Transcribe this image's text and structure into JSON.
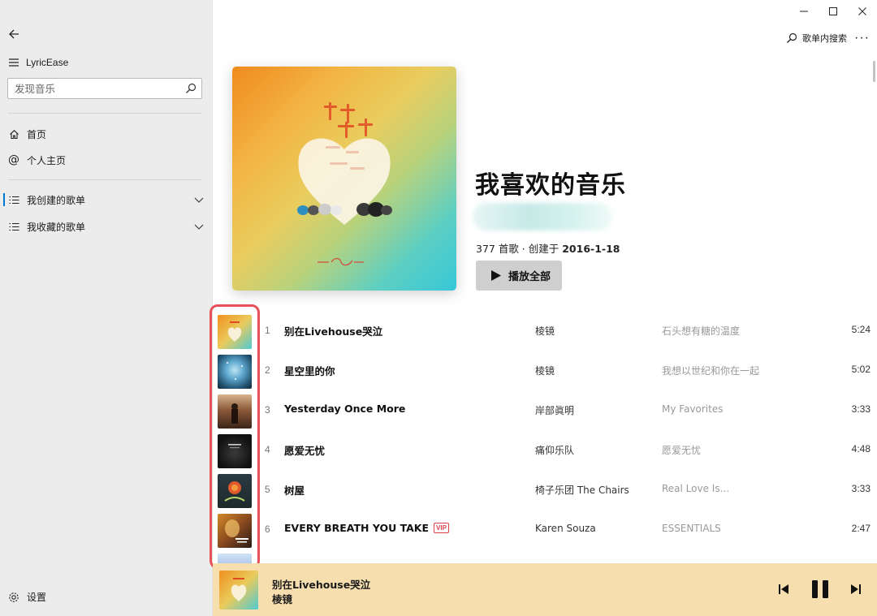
{
  "sidebar": {
    "app_name": "LyricEase",
    "search_placeholder": "发现音乐",
    "nav": [
      {
        "label": "首页",
        "icon": "home-icon"
      },
      {
        "label": "个人主页",
        "icon": "at-icon"
      }
    ],
    "playlist_groups": [
      {
        "label": "我创建的歌单",
        "icon": "list-icon",
        "selected": true
      },
      {
        "label": "我收藏的歌单",
        "icon": "list-icon",
        "selected": false
      }
    ],
    "settings_label": "设置"
  },
  "header": {
    "search_in_playlist": "歌单内搜索",
    "more_label": "···"
  },
  "playlist": {
    "title": "我喜欢的音乐",
    "meta_prefix": "377 首歌 · 创建于 ",
    "created_date": "2016-1-18",
    "play_all_label": "播放全部"
  },
  "tracks": [
    {
      "index": "1",
      "title": "别在Livehouse哭泣",
      "artist": "棱镜",
      "album": "石头想有糖的温度",
      "duration": "5:24",
      "vip": false
    },
    {
      "index": "2",
      "title": "星空里的你",
      "artist": "棱镜",
      "album": "我想以世纪和你在一起",
      "duration": "5:02",
      "vip": false
    },
    {
      "index": "3",
      "title": "Yesterday Once More",
      "artist": "岸部眞明",
      "album": "My Favorites",
      "duration": "3:33",
      "vip": false
    },
    {
      "index": "4",
      "title": "愿爱无忧",
      "artist": "痛仰乐队",
      "album": "愿爱无忧",
      "duration": "4:48",
      "vip": false
    },
    {
      "index": "5",
      "title": "树屋",
      "artist": "椅子乐团 The Chairs",
      "album": "Real Love Is...",
      "duration": "3:33",
      "vip": false
    },
    {
      "index": "6",
      "title": "EVERY BREATH YOU TAKE",
      "artist": "Karen Souza",
      "album": "ESSENTIALS",
      "duration": "2:47",
      "vip": true,
      "vip_label": "VIP"
    }
  ],
  "now_playing": {
    "title": "别在Livehouse哭泣",
    "artist": "棱镜"
  },
  "colors": {
    "accent": "#0078d4",
    "highlight": "#e9515a",
    "now_playing_bg": "#f6deaf",
    "vip": "#e2414b"
  }
}
